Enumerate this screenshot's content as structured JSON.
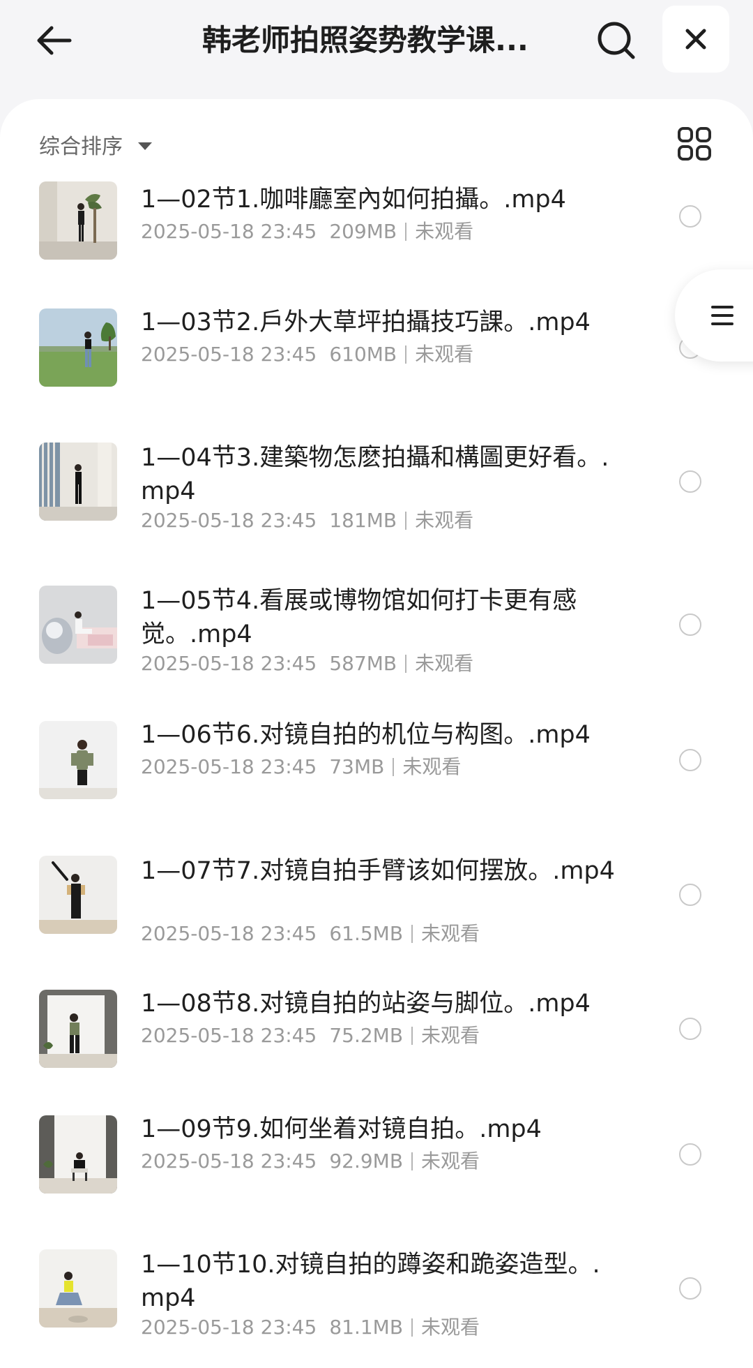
{
  "header": {
    "title": "韩老师拍照姿势教学课...",
    "back_icon": "arrow-left-icon",
    "search_icon": "search-icon",
    "close_icon": "close-icon"
  },
  "toolbar": {
    "sort_label": "综合排序",
    "sort_icon": "caret-down-icon",
    "view_toggle_icon": "grid-view-icon"
  },
  "side_menu": {
    "icon": "list-menu-icon"
  },
  "files": [
    {
      "name": "1—02节1.咖啡廳室內如何拍攝。.mp4",
      "date": "2025-05-18 23:45",
      "size": "209MB",
      "status": "未观看"
    },
    {
      "name": "1—03节2.戶外大草坪拍攝技巧課。.mp4",
      "date": "2025-05-18 23:45",
      "size": "610MB",
      "status": "未观看"
    },
    {
      "name": "1—04节3.建築物怎麽拍攝和構圖更好看。.mp4",
      "date": "2025-05-18 23:45",
      "size": "181MB",
      "status": "未观看"
    },
    {
      "name": "1—05节4.看展或博物馆如何打卡更有感觉。.mp4",
      "date": "2025-05-18 23:45",
      "size": "587MB",
      "status": "未观看"
    },
    {
      "name": "1—06节6.对镜自拍的机位与构图。.mp4",
      "date": "2025-05-18 23:45",
      "size": "73MB",
      "status": "未观看"
    },
    {
      "name": "1—07节7.对镜自拍手臂该如何摆放。.mp4",
      "date": "2025-05-18 23:45",
      "size": "61.5MB",
      "status": "未观看"
    },
    {
      "name": "1—08节8.对镜自拍的站姿与脚位。.mp4",
      "date": "2025-05-18 23:45",
      "size": "75.2MB",
      "status": "未观看"
    },
    {
      "name": "1—09节9.如何坐着对镜自拍。.mp4",
      "date": "2025-05-18 23:45",
      "size": "92.9MB",
      "status": "未观看"
    },
    {
      "name": "1—10节10.对镜自拍的蹲姿和跪姿造型。.mp4",
      "date": "2025-05-18 23:45",
      "size": "81.1MB",
      "status": "未观看"
    }
  ]
}
